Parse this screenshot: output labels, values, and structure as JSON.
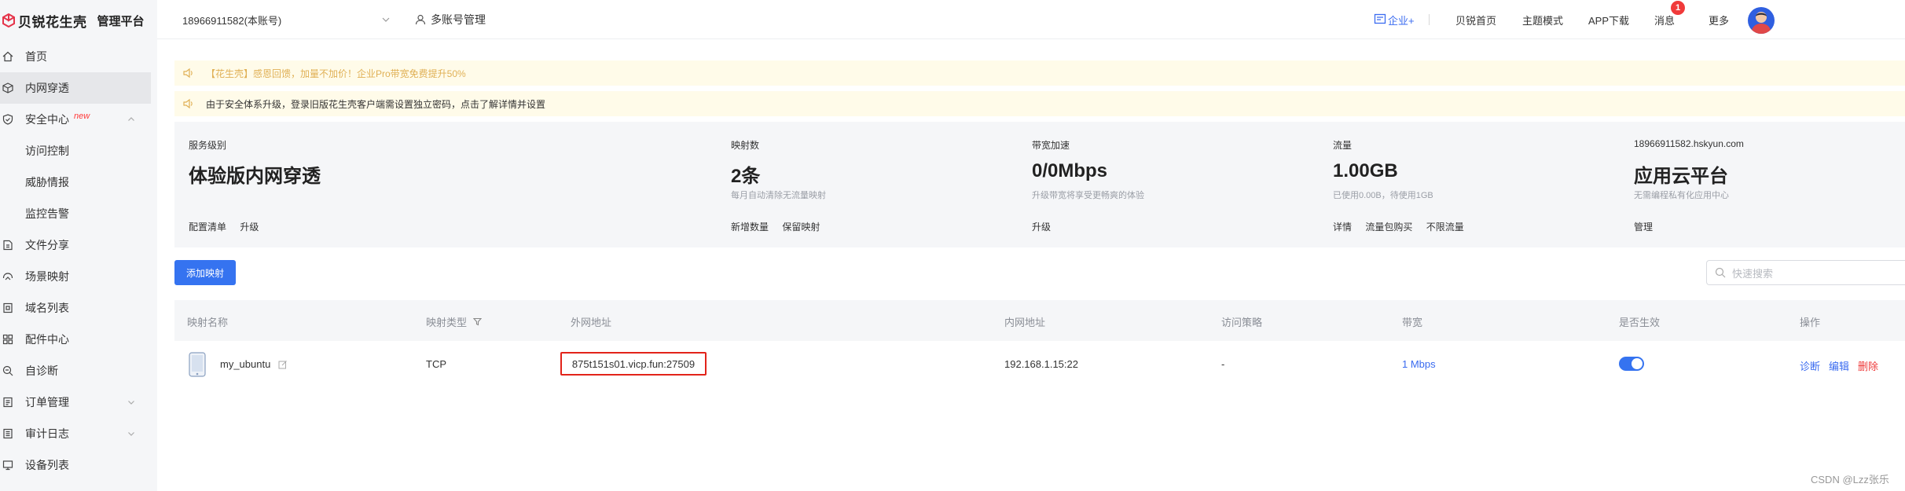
{
  "brand": {
    "name": "贝锐花生壳",
    "subtitle": "管理平台"
  },
  "sidebar": {
    "items": [
      {
        "label": "首页",
        "icon": "home-icon"
      },
      {
        "label": "内网穿透",
        "icon": "cube-icon",
        "active": true
      },
      {
        "label": "安全中心",
        "icon": "shield-icon",
        "badge": "new",
        "expanded": true
      },
      {
        "label": "访问控制"
      },
      {
        "label": "威胁情报"
      },
      {
        "label": "监控告警"
      },
      {
        "label": "文件分享",
        "icon": "file-share-icon"
      },
      {
        "label": "场景映射",
        "icon": "scene-icon"
      },
      {
        "label": "域名列表",
        "icon": "domain-icon"
      },
      {
        "label": "配件中心",
        "icon": "apps-icon"
      },
      {
        "label": "自诊断",
        "icon": "diagnose-icon"
      },
      {
        "label": "订单管理",
        "icon": "order-icon",
        "expandable": true
      },
      {
        "label": "审计日志",
        "icon": "log-icon",
        "expandable": true
      },
      {
        "label": "设备列表",
        "icon": "device-icon"
      }
    ]
  },
  "topbar": {
    "account": "18966911582(本账号)",
    "multi_account": "多账号管理",
    "links": {
      "enterprise": "企业+",
      "home": "贝锐首页",
      "theme": "主题模式",
      "app": "APP下载",
      "messages": "消息",
      "more": "更多"
    },
    "message_count": "1"
  },
  "notices": [
    "【花生壳】感恩回馈，加量不加价！企业Pro带宽免费提升50%",
    "由于安全体系升级，登录旧版花生壳客户端需设置独立密码，点击了解详情并设置"
  ],
  "stats": {
    "service": {
      "label": "服务级别",
      "value": "体验版内网穿透",
      "note": "",
      "links": [
        "配置清单",
        "升级"
      ]
    },
    "mappings": {
      "label": "映射数",
      "value": "2条",
      "note": "每月自动清除无流量映射",
      "links": [
        "新增数量",
        "保留映射"
      ]
    },
    "bandwidth": {
      "label": "带宽加速",
      "value": "0/0Mbps",
      "note": "升级带宽将享受更畅爽的体验",
      "links": [
        "升级"
      ]
    },
    "traffic": {
      "label": "流量",
      "value": "1.00GB",
      "note": "已使用0.00B，待使用1GB",
      "links": [
        "详情",
        "流量包购买",
        "不限流量"
      ]
    },
    "cloud": {
      "label": "18966911582.hskyun.com",
      "value": "应用云平台",
      "note": "无需编程私有化应用中心",
      "links": [
        "管理"
      ]
    }
  },
  "toolbar": {
    "add_button": "添加映射",
    "search_placeholder": "快速搜索"
  },
  "table": {
    "columns": [
      "映射名称",
      "映射类型",
      "外网地址",
      "内网地址",
      "访问策略",
      "带宽",
      "是否生效",
      "操作"
    ],
    "rows": [
      {
        "name": "my_ubuntu",
        "type": "TCP",
        "external": "875t151s01.vicp.fun:27509",
        "internal": "192.168.1.15:22",
        "policy": "-",
        "bandwidth": "1 Mbps",
        "enabled": true,
        "ops": [
          "诊断",
          "编辑",
          "删除"
        ]
      }
    ]
  },
  "watermark": "CSDN @Lzz张乐",
  "colors": {
    "accent": "#3573f0",
    "danger": "#e2231a",
    "notice_bg": "#fffbe9",
    "brand_red": "#e5344a"
  }
}
